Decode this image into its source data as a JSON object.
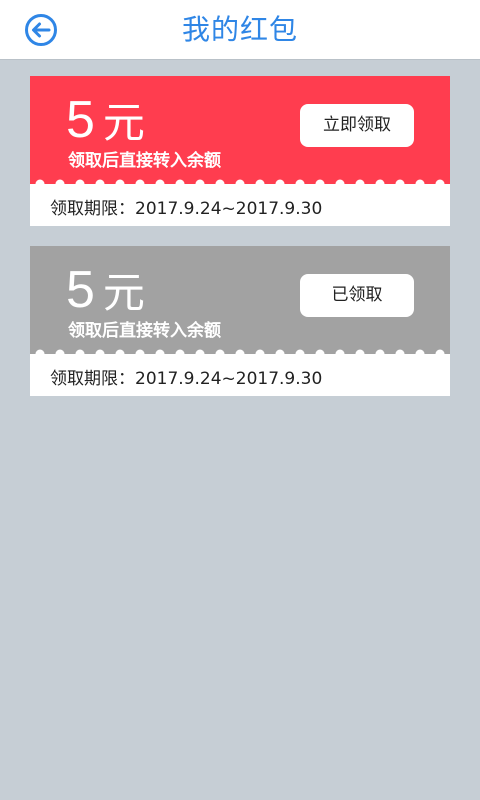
{
  "header": {
    "back_icon": "arrow-left-circle-icon",
    "title": "我的红包"
  },
  "colors": {
    "accent": "#2f86e6",
    "active_card": "#ff3d4f",
    "claimed_card": "#a2a2a2",
    "background": "#c6ced5"
  },
  "cards": [
    {
      "amount": "5",
      "unit": "元",
      "description": "领取后直接转入余额",
      "action_label": "立即领取",
      "period": "领取期限：2017.9.24~2017.9.30",
      "status": "available"
    },
    {
      "amount": "5",
      "unit": "元",
      "description": "领取后直接转入余额",
      "action_label": "已领取",
      "period": "领取期限：2017.9.24~2017.9.30",
      "status": "claimed"
    }
  ]
}
